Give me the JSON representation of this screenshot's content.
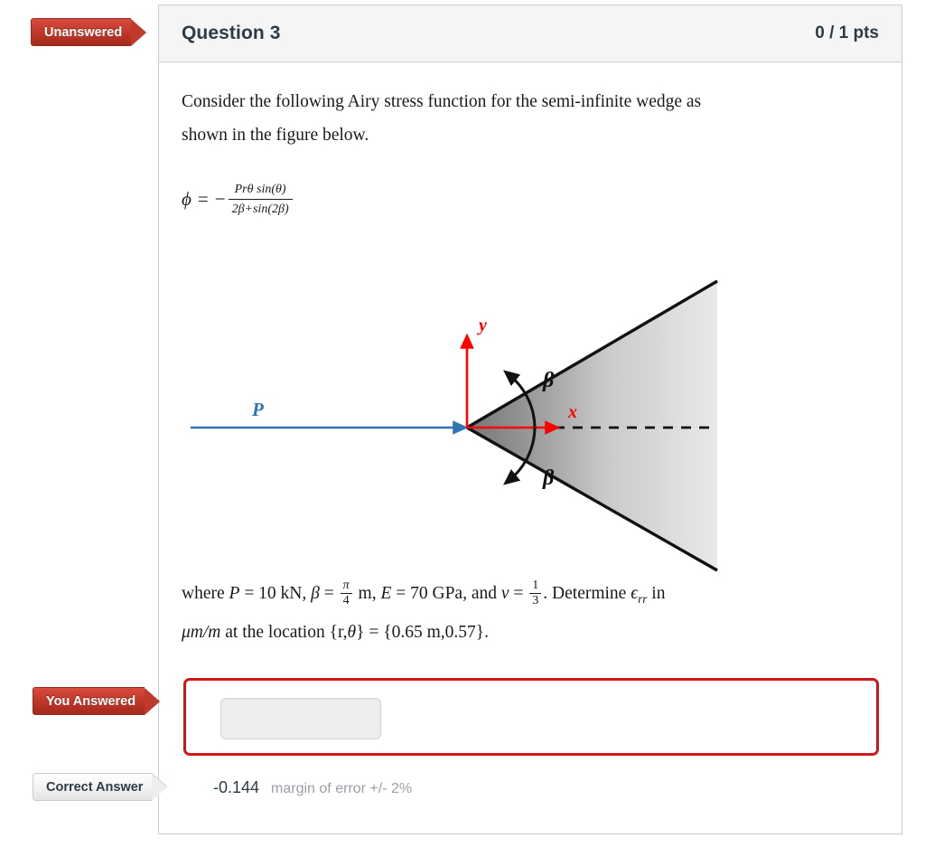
{
  "question": {
    "title": "Question 3",
    "points": "0 / 1 pts",
    "status_badge": "Unanswered",
    "intro_line1": "Consider the following Airy stress function for the semi-infinite wedge as",
    "intro_line2": "shown in the figure below.",
    "formula": {
      "lhs": "ϕ",
      "equals": "=",
      "minus": "−",
      "numerator": "Prθ sin(θ)",
      "denominator": "2β+sin(2β)"
    },
    "where": {
      "lead": "where ",
      "P_sym": "P",
      "P_eq": " = 10 kN, ",
      "beta_sym": "β",
      "beta_eq": " = ",
      "beta_num": "π",
      "beta_den": "4",
      "beta_unit": " m, ",
      "E_sym": "E",
      "E_eq": " = 70 GPa, and ",
      "nu_sym": "ν",
      "nu_eq": " = ",
      "nu_num": "1",
      "nu_den": "3",
      "determine": ". Determine ",
      "strain_sym": "ϵ",
      "strain_sub": "rr",
      "in_word": " in",
      "units": "μm/m",
      "loc_lead": " at the location {r,",
      "theta_sym": "θ",
      "loc_mid": "} = {0.65 m,0.57}."
    }
  },
  "figure": {
    "label_P": "P",
    "label_x": "x",
    "label_y": "y",
    "label_beta_top": "β",
    "label_beta_bottom": "β",
    "colors": {
      "force_arrow": "#2e75b6",
      "axis": "#ff0000",
      "wedge_edge": "#111111",
      "wedge_fill_dark": "#808080",
      "wedge_fill_light": "#e8e8e8"
    }
  },
  "answer": {
    "you_answered_badge": "You Answered",
    "student_value": "",
    "student_placeholder": "",
    "correct_badge": "Correct Answer",
    "correct_value": "-0.144",
    "margin_of_error": "margin of error +/- 2%"
  },
  "theme": {
    "accent_red": "#c0392b",
    "border_red": "#d01616",
    "header_bg": "#f5f5f5",
    "border_grey": "#c7cdd1",
    "text_dark": "#2d3b45"
  }
}
